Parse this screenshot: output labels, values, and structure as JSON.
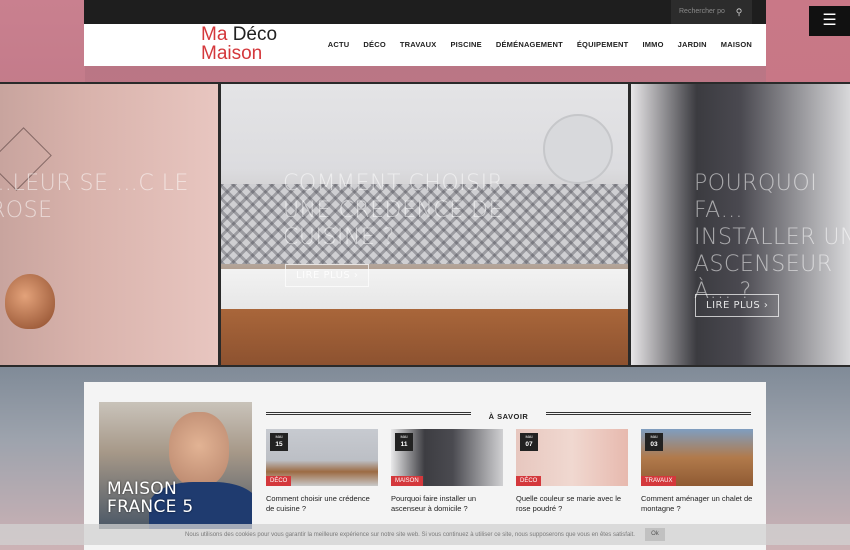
{
  "topbar": {
    "search_placeholder": "Rechercher po",
    "search_icon": "search-icon",
    "menu_icon": "hamburger-icon",
    "menu_glyph": "☰"
  },
  "logo": {
    "line1_ma": "Ma",
    "line1_deco": "Déco",
    "line2": "Maison"
  },
  "nav": {
    "items": [
      "ACTU",
      "DÉCO",
      "TRAVAUX",
      "PISCINE",
      "DÉMÉNAGEMENT",
      "ÉQUIPEMENT",
      "IMMO",
      "JARDIN",
      "MAISON"
    ]
  },
  "slides": [
    {
      "title": "…LEUR SE …C LE ROSE"
    },
    {
      "title": "COMMENT CHOISIR UNE CRÉDENCE DE CUISINE ?",
      "readmore": "LIRE PLUS ›"
    },
    {
      "title": "POURQUOI FA… INSTALLER UN ASCENSEUR À… ?",
      "readmore": "LIRE PLUS ›"
    }
  ],
  "feature": {
    "title_line1": "MAISON",
    "title_line2": "FRANCE 5"
  },
  "section": {
    "title": "À SAVOIR"
  },
  "cards": [
    {
      "month": "MAI",
      "day": "15",
      "category": "DÉCO",
      "title": "Comment choisir une crédence de cuisine ?"
    },
    {
      "month": "MAI",
      "day": "11",
      "category": "MAISON",
      "title": "Pourquoi faire installer un ascenseur à domicile ?"
    },
    {
      "month": "MAI",
      "day": "07",
      "category": "DÉCO",
      "title": "Quelle couleur se marie avec le rose poudré ?"
    },
    {
      "month": "MAI",
      "day": "03",
      "category": "TRAVAUX",
      "title": "Comment aménager un chalet de montagne ?"
    }
  ],
  "cookie": {
    "text": "Nous utilisons des cookies pour vous garantir la meilleure expérience sur notre site web. Si vous continuez à utiliser ce site, nous supposerons que vous en êtes satisfait.",
    "ok": "Ok"
  },
  "colors": {
    "brand_red": "#d4383c",
    "dark": "#1e1e1e"
  }
}
